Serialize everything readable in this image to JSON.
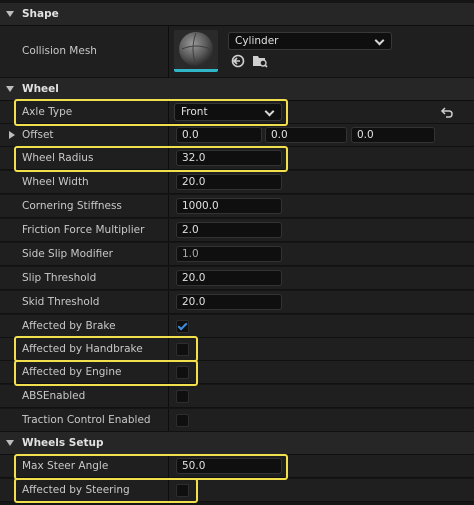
{
  "shape": {
    "title": "Shape",
    "collision_mesh": {
      "label": "Collision Mesh",
      "value": "Cylinder"
    }
  },
  "wheel": {
    "title": "Wheel",
    "axle_type": {
      "label": "Axle Type",
      "value": "Front"
    },
    "offset": {
      "label": "Offset",
      "x": "0.0",
      "y": "0.0",
      "z": "0.0"
    },
    "wheel_radius": {
      "label": "Wheel Radius",
      "value": "32.0"
    },
    "wheel_width": {
      "label": "Wheel Width",
      "value": "20.0"
    },
    "cornering_stiffness": {
      "label": "Cornering Stiffness",
      "value": "1000.0"
    },
    "friction_force_multiplier": {
      "label": "Friction Force Multiplier",
      "value": "2.0"
    },
    "side_slip_modifier": {
      "label": "Side Slip Modifier",
      "value": "1.0"
    },
    "slip_threshold": {
      "label": "Slip Threshold",
      "value": "20.0"
    },
    "skid_threshold": {
      "label": "Skid Threshold",
      "value": "20.0"
    },
    "affected_by_brake": {
      "label": "Affected by Brake",
      "checked": true
    },
    "affected_by_handbrake": {
      "label": "Affected by Handbrake",
      "checked": false
    },
    "affected_by_engine": {
      "label": "Affected by Engine",
      "checked": false
    },
    "abs_enabled": {
      "label": "ABSEnabled",
      "checked": false
    },
    "traction_control_enabled": {
      "label": "Traction Control Enabled",
      "checked": false
    }
  },
  "wheels_setup": {
    "title": "Wheels Setup",
    "max_steer_angle": {
      "label": "Max Steer Angle",
      "value": "50.0"
    },
    "affected_by_steering": {
      "label": "Affected by Steering",
      "checked": false
    }
  },
  "colors": {
    "highlight": "#f2df4e",
    "check_accent": "#3d8fe0",
    "thumbnail_underline": "#2fb7c9"
  },
  "icons": [
    "reset-to-default-icon",
    "browse-to-asset-icon",
    "use-selected-asset-icon",
    "chevron-down-icon",
    "checkmark-icon",
    "expand-arrow-icon",
    "collapse-arrow-icon"
  ]
}
